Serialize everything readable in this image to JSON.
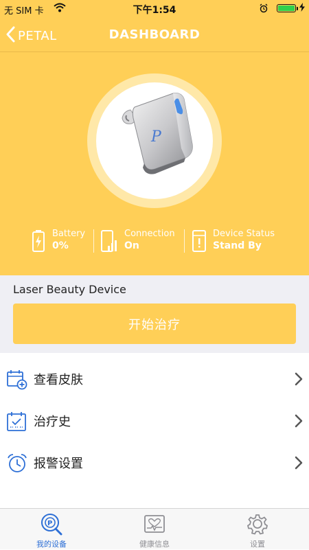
{
  "status_bar": {
    "carrier": "无 SIM 卡",
    "time": "下午1:54",
    "icons": [
      "wifi-icon",
      "alarm-icon",
      "battery-icon",
      "charging-icon"
    ]
  },
  "nav": {
    "back_label": "PETAL",
    "title": "DASHBOARD"
  },
  "device": {
    "image": "petal-laser-device",
    "logo_letter": "P"
  },
  "stats": [
    {
      "icon": "battery-icon",
      "label": "Battery",
      "value": "0%"
    },
    {
      "icon": "signal-icon",
      "label": "Connection",
      "value": "On"
    },
    {
      "icon": "alert-icon",
      "label": "Device Status",
      "value": "Stand By"
    }
  ],
  "device_section": {
    "name": "Laser Beauty Device",
    "start_button": "开始治疗"
  },
  "menu": [
    {
      "icon": "calendar-plus-icon",
      "label": "查看皮肤"
    },
    {
      "icon": "calendar-check-icon",
      "label": "治疗史"
    },
    {
      "icon": "alarm-clock-icon",
      "label": "报警设置"
    }
  ],
  "tabs": [
    {
      "icon": "search-device-icon",
      "label": "我的设备",
      "active": true
    },
    {
      "icon": "health-monitor-icon",
      "label": "健康信息",
      "active": false
    },
    {
      "icon": "gear-icon",
      "label": "设置",
      "active": false
    }
  ],
  "colors": {
    "brand_yellow": "#ffcf57",
    "section_gray": "#efeff4",
    "menu_icon_blue": "#2d6fd6",
    "tab_active": "#2d6fd6",
    "tab_inactive": "#8e8e93"
  }
}
